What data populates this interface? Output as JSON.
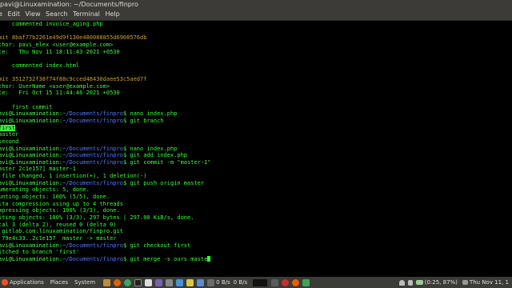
{
  "window": {
    "title": "pavi@Linuxamination: ~/Documents/finpro"
  },
  "menu": [
    "e",
    "Edit",
    "View",
    "Search",
    "Terminal",
    "Help"
  ],
  "terminal": {
    "lines": [
      [
        {
          "t": "    commented invoice_aging.php",
          "c": "c-green"
        }
      ],
      [
        {
          "t": "",
          "c": ""
        }
      ],
      [
        {
          "t": "mit 8baf77b2261e49d9f130e480088855d6908576db",
          "c": "c-yellow"
        }
      ],
      [
        {
          "t": "thor: pavi_elex <user@example.com>",
          "c": "c-green"
        }
      ],
      [
        {
          "t": "te:   Thu Nov 11 18:11:43 2021 +0530",
          "c": "c-green"
        }
      ],
      [
        {
          "t": "",
          "c": ""
        }
      ],
      [
        {
          "t": "    commented index.html",
          "c": "c-green"
        }
      ],
      [
        {
          "t": "",
          "c": ""
        }
      ],
      [
        {
          "t": "mit 3512732f38f74f88c9cced48430daee53c5aed7f",
          "c": "c-yellow"
        }
      ],
      [
        {
          "t": "thor: UserName <user@example.com>",
          "c": "c-green"
        }
      ],
      [
        {
          "t": "te:   Fri Oct 15 11:44:46 2021 +0530",
          "c": "c-green"
        }
      ],
      [
        {
          "t": "",
          "c": ""
        }
      ],
      [
        {
          "t": "    first commit",
          "c": "c-green"
        }
      ],
      [
        {
          "t": "avi@Linuxamination",
          "c": "c-prompt"
        },
        {
          "t": ":",
          "c": "c-green"
        },
        {
          "t": "~/Documents/finpro",
          "c": "c-path"
        },
        {
          "t": "$ nano index.php",
          "c": "c-green"
        }
      ],
      [
        {
          "t": "avi@Linuxamination",
          "c": "c-prompt"
        },
        {
          "t": ":",
          "c": "c-green"
        },
        {
          "t": "~/Documents/finpro",
          "c": "c-path"
        },
        {
          "t": "$ git branch",
          "c": "c-green"
        }
      ],
      [
        {
          "t": "first",
          "c": "c-hl"
        }
      ],
      [
        {
          "t": "master",
          "c": "c-green"
        }
      ],
      [
        {
          "t": "second",
          "c": "c-green"
        }
      ],
      [
        {
          "t": "avi@Linuxamination",
          "c": "c-prompt"
        },
        {
          "t": ":",
          "c": "c-green"
        },
        {
          "t": "~/Documents/finpro",
          "c": "c-path"
        },
        {
          "t": "$ nano index.php",
          "c": "c-green"
        }
      ],
      [
        {
          "t": "avi@Linuxamination",
          "c": "c-prompt"
        },
        {
          "t": ":",
          "c": "c-green"
        },
        {
          "t": "~/Documents/finpro",
          "c": "c-path"
        },
        {
          "t": "$ git add index.php",
          "c": "c-green"
        }
      ],
      [
        {
          "t": "avi@Linuxamination",
          "c": "c-prompt"
        },
        {
          "t": ":",
          "c": "c-green"
        },
        {
          "t": "~/Documents/finpro",
          "c": "c-path"
        },
        {
          "t": "$ git commit -m \"master-1\"",
          "c": "c-green"
        }
      ],
      [
        {
          "t": "aster 2c1e157] master-1",
          "c": "c-green"
        }
      ],
      [
        {
          "t": " file changed, 1 insertion(+), 1 deletion(-)",
          "c": "c-green"
        }
      ],
      [
        {
          "t": "avi@Linuxamination",
          "c": "c-prompt"
        },
        {
          "t": ":",
          "c": "c-green"
        },
        {
          "t": "~/Documents/finpro",
          "c": "c-path"
        },
        {
          "t": "$ git push origin master",
          "c": "c-green"
        }
      ],
      [
        {
          "t": "umerating objects: 5, done.",
          "c": "c-green"
        }
      ],
      [
        {
          "t": "unting objects: 100% (5/5), done.",
          "c": "c-green"
        }
      ],
      [
        {
          "t": "lta compression using up to 4 threads",
          "c": "c-green"
        }
      ],
      [
        {
          "t": "mpressing objects: 100% (3/3), done.",
          "c": "c-green"
        }
      ],
      [
        {
          "t": "iting objects: 100% (3/3), 297 bytes | 297.00 KiB/s, done.",
          "c": "c-green"
        }
      ],
      [
        {
          "t": "tal 3 (delta 2), reused 0 (delta 0)",
          "c": "c-green"
        }
      ],
      [
        {
          "t": " gitlab.com:linuxamination/finpro.git",
          "c": "c-green"
        }
      ],
      [
        {
          "t": " 79e4c33..2c1e157  master -> master",
          "c": "c-green"
        }
      ],
      [
        {
          "t": "avi@Linuxamination",
          "c": "c-prompt"
        },
        {
          "t": ":",
          "c": "c-green"
        },
        {
          "t": "~/Documents/finpro",
          "c": "c-path"
        },
        {
          "t": "$ git checkout first",
          "c": "c-green"
        }
      ],
      [
        {
          "t": "itched to branch 'first'",
          "c": "c-green"
        }
      ],
      [
        {
          "t": "avi@Linuxamination",
          "c": "c-prompt"
        },
        {
          "t": ":",
          "c": "c-green"
        },
        {
          "t": "~/Documents/finpro",
          "c": "c-path"
        },
        {
          "t": "$ git merge -s ours maste",
          "c": "c-green"
        },
        {
          "t": "",
          "c": "cursor"
        }
      ]
    ]
  },
  "taskbar": {
    "applications": "Applications",
    "places": "Places",
    "system": "System",
    "net_down": "0 B/s",
    "net_up": "0 B/s",
    "battery": "(0:25, 87%)",
    "clock": "Thu Nov 11, 1",
    "colors": {
      "bg": "#3b3b38",
      "text": "#e0e0e0"
    }
  }
}
